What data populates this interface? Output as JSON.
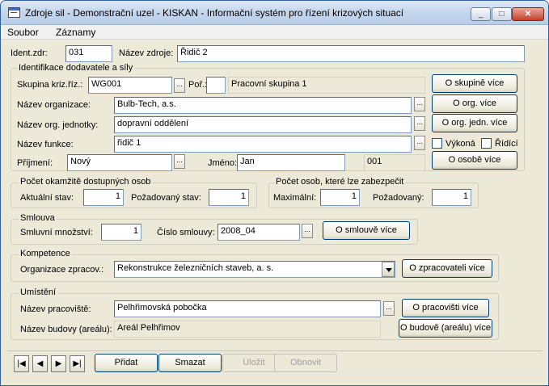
{
  "window": {
    "title": "Zdroje sil - Demonstrační uzel - KISKAN - Informační systém pro řízení krizových situací",
    "controls": {
      "minimize": "_",
      "maximize": "□",
      "close": "✕"
    }
  },
  "menu": [
    "Soubor",
    "Záznamy"
  ],
  "header": {
    "ident_label": "Ident.zdr:",
    "ident_value": "031",
    "name_label": "Název zdroje:",
    "name_value": "Řidič 2"
  },
  "identifikace": {
    "legend": "Identifikace dodavatele a síly",
    "skupina_label": "Skupina kriz.říz.:",
    "skupina_value": "WG001",
    "por_label": "Poř.:",
    "por_value": "",
    "skupina_name": "Pracovní skupina 1",
    "skupina_btn": "O skupině více",
    "org_label": "Název organizace:",
    "org_value": "Bulb-Tech, a.s.",
    "org_btn": "O org. více",
    "jednotka_label": "Název org. jednotky:",
    "jednotka_value": "dopravní oddělení",
    "jednotka_btn": "O org. jedn. více",
    "funkce_label": "Název funkce:",
    "funkce_value": "řidič 1",
    "vykona_label": "Výkoná",
    "ridici_label": "Řídící",
    "prijmeni_label": "Příjmení:",
    "prijmeni_value": "Nový",
    "jmeno_label": "Jméno:",
    "jmeno_value": "Jan",
    "osoba_code": "001",
    "osoba_btn": "O osobě více",
    "dots": "..."
  },
  "okamzite": {
    "legend": "Počet okamžitě dostupných osob",
    "aktualni_label": "Aktuální stav:",
    "aktualni_value": "1",
    "pozadovany_label": "Požadovaný stav:",
    "pozadovany_value": "1"
  },
  "zabezpecit": {
    "legend": "Počet osob, které lze zabezpečit",
    "max_label": "Maximální:",
    "max_value": "1",
    "poz_label": "Požadovaný:",
    "poz_value": "1"
  },
  "smlouva": {
    "legend": "Smlouva",
    "mnozstvi_label": "Smluvní množství:",
    "mnozstvi_value": "1",
    "cislo_label": "Číslo smlouvy:",
    "cislo_value": "2008_04",
    "btn": "O smlouvě více"
  },
  "kompetence": {
    "legend": "Kompetence",
    "org_label": "Organizace zpracov.:",
    "org_value": "Rekonstrukce železničních staveb, a. s.",
    "btn": "O zpracovateli více"
  },
  "umisteni": {
    "legend": "Umístění",
    "pracoviste_label": "Název pracoviště:",
    "pracoviste_value": "Pelhřimovská pobočka",
    "pracoviste_btn": "O pracovišti více",
    "budova_label": "Název budovy (areálu):",
    "budova_value": "Areál Pelhřimov",
    "budova_btn": "O budově (areálu) více"
  },
  "toolbar": {
    "first": "|◀",
    "prev": "◀",
    "next": "▶",
    "last": "▶|",
    "pridat": "Přidat",
    "smazat": "Smazat",
    "ulozit": "Uložit",
    "obnovit": "Obnovit"
  }
}
